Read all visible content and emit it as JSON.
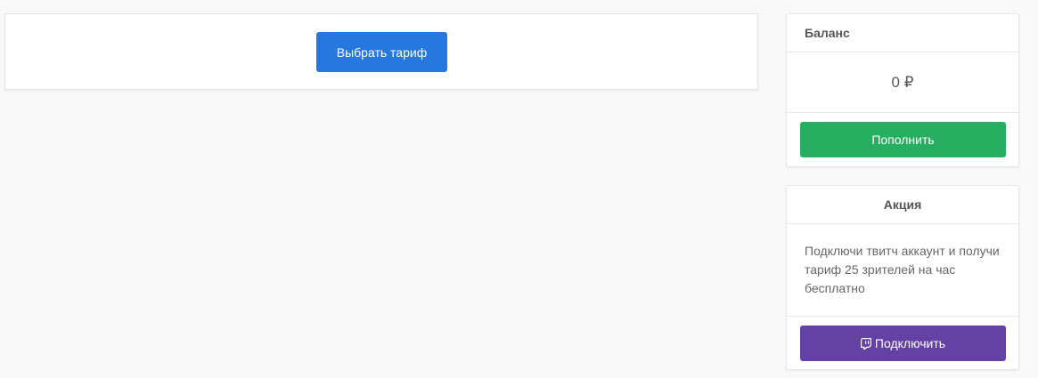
{
  "main": {
    "choose_tariff_label": "Выбрать тариф"
  },
  "balance": {
    "title": "Баланс",
    "amount": "0 ₽",
    "topup_label": "Пополнить"
  },
  "promo": {
    "title": "Акция",
    "text": "Подключи твитч аккаунт и получи тариф 25 зрителей на час бесплатно",
    "connect_label": "Подключить",
    "connect_icon": "twitch-icon"
  },
  "colors": {
    "primary": "#2778de",
    "success": "#28ae60",
    "twitch": "#6441a4",
    "background": "#f8f8f8"
  }
}
